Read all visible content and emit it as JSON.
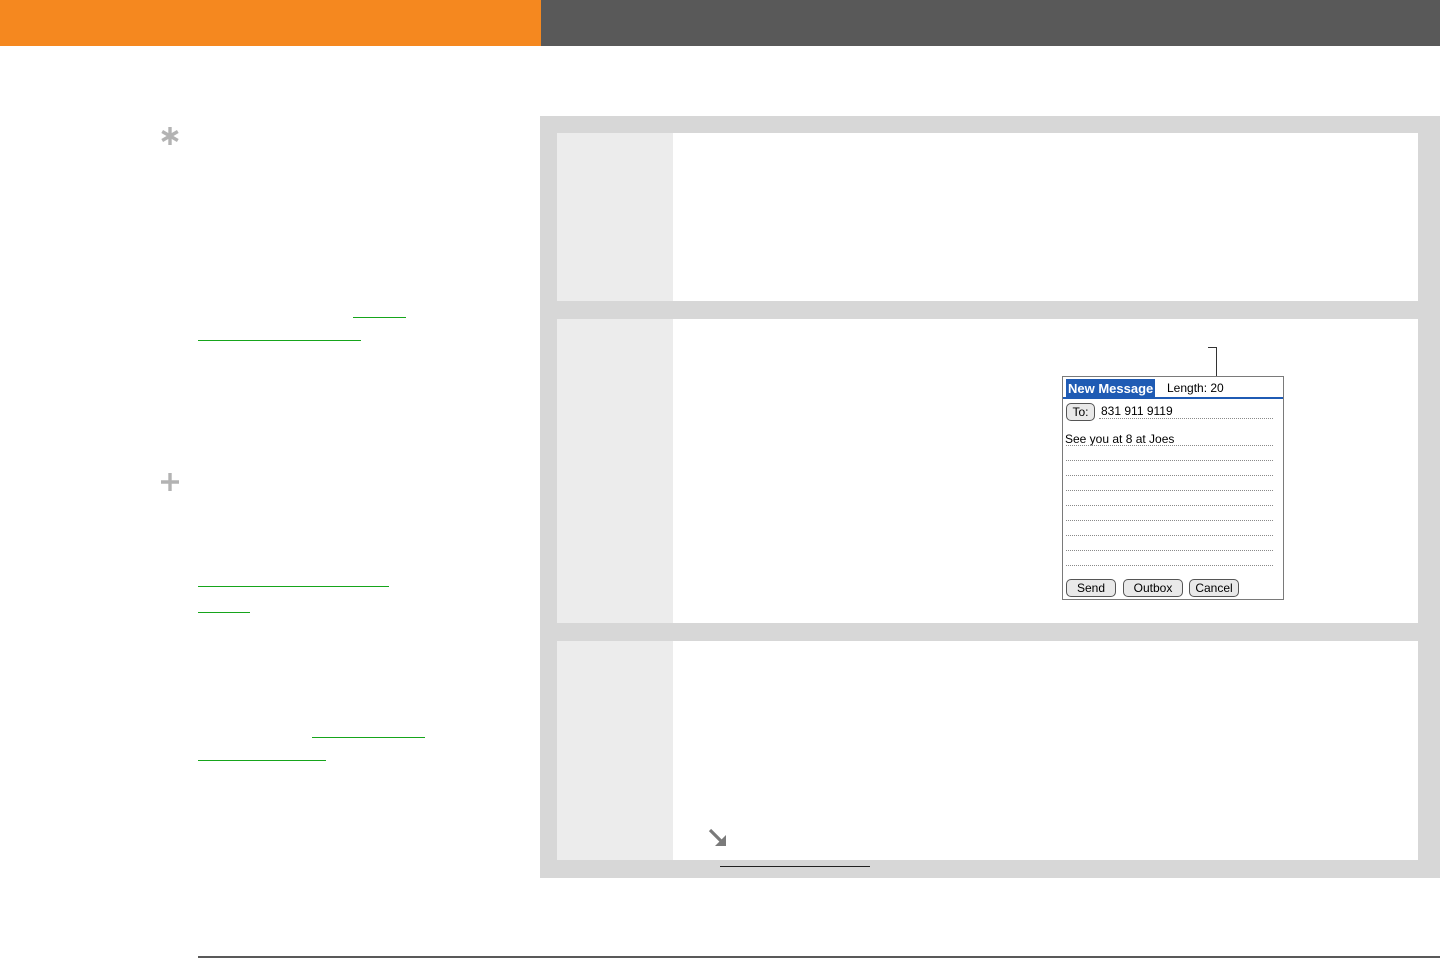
{
  "colors": {
    "header_orange": "#f5881f",
    "header_gray": "#595959",
    "link_green": "#16a51b",
    "panel_gray": "#d7d7d7",
    "step_number_column": "#ececec",
    "palm_blue": "#1f5bb4"
  },
  "margin": {
    "tip_icon": "asterisk-icon",
    "more_icon": "plus-icon"
  },
  "steps": {
    "continue_icon": "arrow-down-right-icon"
  },
  "palm": {
    "title": "New Message",
    "length_label": "Length: 20",
    "to_button": "To:",
    "to_value": "831 911 9119",
    "message_body": "See you at 8 at Joes",
    "buttons": {
      "send": "Send",
      "outbox": "Outbox",
      "cancel": "Cancel"
    }
  }
}
